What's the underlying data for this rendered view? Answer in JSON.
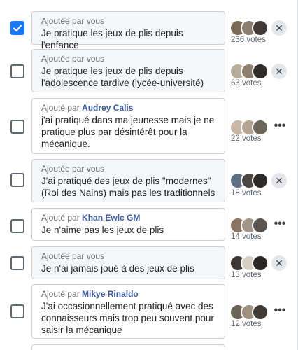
{
  "options": [
    {
      "meta_prefix": "Ajoutée par vous",
      "author": "",
      "text": "Je pratique les jeux de plis depuis l'enfance",
      "votes": "236 votes",
      "checked": true,
      "mine": true,
      "action": "remove"
    },
    {
      "meta_prefix": "Ajoutée par vous",
      "author": "",
      "text": "Je pratique les jeux de plis depuis l'adolescence tardive (lycée-université)",
      "votes": "63 votes",
      "checked": false,
      "mine": true,
      "action": "remove"
    },
    {
      "meta_prefix": "Ajouté par ",
      "author": "Audrey Calis",
      "text": "j'ai pratiqué dans ma jeunesse mais je ne pratique plus par désintérêt pour la mécanique.",
      "votes": "22 votes",
      "checked": false,
      "mine": false,
      "action": "more"
    },
    {
      "meta_prefix": "Ajoutée par vous",
      "author": "",
      "text": "J'ai pratiqué des jeux de plis \"modernes\" (Roi des Nains) mais pas les traditionnels",
      "votes": "18 votes",
      "checked": false,
      "mine": true,
      "action": "remove"
    },
    {
      "meta_prefix": "Ajouté par ",
      "author": "Khan Ewlc GM",
      "text": "Je n'aime pas les jeux de plis",
      "votes": "14 votes",
      "checked": false,
      "mine": false,
      "action": "more"
    },
    {
      "meta_prefix": "Ajoutée par vous",
      "author": "",
      "text": "Je n'ai jamais joué à des jeux de plis",
      "votes": "13 votes",
      "checked": false,
      "mine": true,
      "action": "remove"
    },
    {
      "meta_prefix": "Ajouté par ",
      "author": "Mikye Rinaldo",
      "text": "J'ai occasionnellement pratiqué avec des connaisseurs mais trop peu souvent pour saisir la mécanique",
      "votes": "12 votes",
      "checked": false,
      "mine": false,
      "action": "more"
    }
  ],
  "icons": {
    "checkbox_check": "check-icon",
    "remove": "close-icon",
    "more": "more-horizontal-icon"
  },
  "glyphs": {
    "remove": "✕",
    "more": "•••"
  },
  "colors": {
    "accent": "#1877f2",
    "author_link": "#385898",
    "muted": "#65676b",
    "border": "#ccd0d5"
  }
}
